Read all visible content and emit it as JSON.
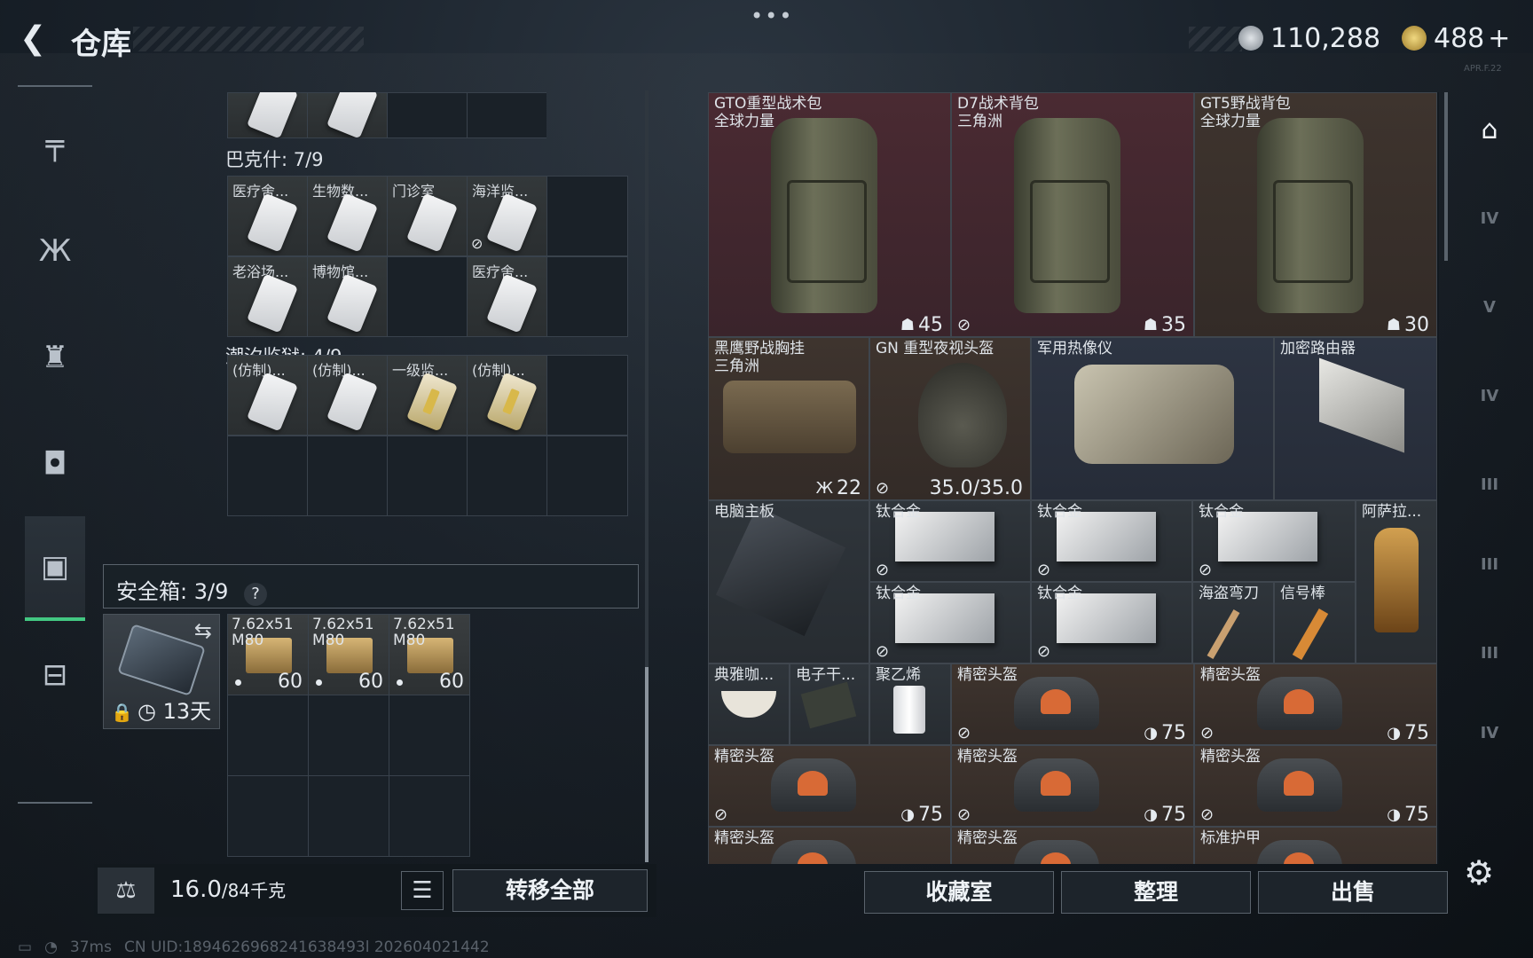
{
  "header": {
    "back_icon": "back-arrow-icon",
    "title": "仓库",
    "menu": "•••",
    "currency1": "110,288",
    "currency2": "488",
    "currency2_plus": "+",
    "version": "APR.F.22"
  },
  "sidebar": {
    "items": [
      {
        "icon": "gun-icon",
        "glyph": "╤"
      },
      {
        "icon": "vest-icon",
        "glyph": "Ж"
      },
      {
        "icon": "armor-icon",
        "glyph": "♜"
      },
      {
        "icon": "backpack-icon",
        "glyph": "◘"
      },
      {
        "icon": "case-icon",
        "glyph": "▣"
      },
      {
        "icon": "briefcase-icon",
        "glyph": "⊟"
      }
    ],
    "active": 4
  },
  "stash": {
    "section1": {
      "header": "巴克什: 7/9",
      "rows": [
        [
          "医疗舍...",
          "生物数...",
          "门诊室",
          "海洋监..."
        ],
        [
          "老浴场...",
          "博物馆...",
          "",
          "医疗舍..."
        ]
      ]
    },
    "section2": {
      "header": "潮汐监狱: 4/9",
      "rows": [
        [
          "(仿制)...",
          "(仿制)...",
          "一级监...",
          "(仿制)..."
        ]
      ]
    }
  },
  "safebox": {
    "label": "安全箱: 3/9",
    "help": "?",
    "case_days": "13天",
    "ammo": [
      {
        "label": "7.62x51 M80",
        "qty": "60"
      },
      {
        "label": "7.62x51 M80",
        "qty": "60"
      },
      {
        "label": "7.62x51 M80",
        "qty": "60"
      }
    ]
  },
  "weight": {
    "current": "16.0",
    "max": "/84千克",
    "icon": "kg-weight-icon"
  },
  "buttons": {
    "transfer_all": "转移全部",
    "list_icon": "list-icon",
    "collection": "收藏室",
    "organize": "整理",
    "sell": "出售"
  },
  "loot": [
    {
      "name": "GTO重型战术包\n全球力量",
      "value": "45",
      "nonsell": false
    },
    {
      "name": "D7战术背包\n三角洲",
      "value": "35",
      "nonsell": true
    },
    {
      "name": "GT5野战背包\n全球力量",
      "value": "30",
      "nonsell": false
    },
    {
      "name": "黑鹰野战胸挂\n三角洲",
      "value": "22"
    },
    {
      "name": "GN 重型夜视头盔",
      "value": "35.0/35.0"
    },
    {
      "name": "军用热像仪"
    },
    {
      "name": "加密路由器"
    },
    {
      "name": "电脑主板"
    },
    {
      "name": "钛合金"
    },
    {
      "name": "钛合金"
    },
    {
      "name": "钛合金"
    },
    {
      "name": "钛合金"
    },
    {
      "name": "钛合金"
    },
    {
      "name": "阿萨拉..."
    },
    {
      "name": "海盗弯刀"
    },
    {
      "name": "信号棒"
    },
    {
      "name": "典雅咖..."
    },
    {
      "name": "电子干..."
    },
    {
      "name": "聚乙烯"
    },
    {
      "name": "精密头盔",
      "value": "75"
    },
    {
      "name": "精密头盔",
      "value": "75"
    },
    {
      "name": "精密头盔",
      "value": "75"
    },
    {
      "name": "精密头盔",
      "value": "75"
    },
    {
      "name": "精密头盔",
      "value": "75"
    },
    {
      "name": "精密头盔"
    },
    {
      "name": "精密头盔"
    },
    {
      "name": "标准护甲"
    }
  ],
  "rightbar": [
    {
      "icon": "container-icon",
      "glyph": "⌂"
    },
    {
      "icon": "tier-iv-icon",
      "glyph": "IV"
    },
    {
      "icon": "tier-v-icon",
      "glyph": "V"
    },
    {
      "icon": "tier-iv-icon",
      "glyph": "IV"
    },
    {
      "icon": "tier-iii-icon",
      "glyph": "III"
    },
    {
      "icon": "tier-iii-icon",
      "glyph": "III"
    },
    {
      "icon": "tier-iii-icon",
      "glyph": "III"
    },
    {
      "icon": "tier-iv-icon",
      "glyph": "IV"
    }
  ],
  "status": {
    "ping": "37ms",
    "uid": "CN UID:1894626968241638493l 202604021442"
  }
}
